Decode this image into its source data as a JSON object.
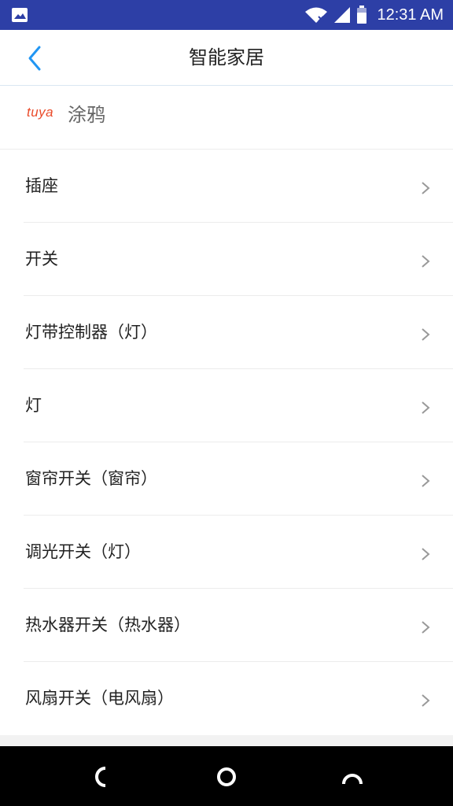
{
  "status_bar": {
    "time": "12:31 AM",
    "icons": [
      "image-icon",
      "wifi-icon",
      "signal-icon",
      "battery-icon"
    ]
  },
  "header": {
    "back_icon": "chevron-left-icon",
    "title": "智能家居"
  },
  "brand": {
    "logo_text": "tuya",
    "name": "涂鸦"
  },
  "list": {
    "items": [
      {
        "label": "插座"
      },
      {
        "label": "开关"
      },
      {
        "label": "灯带控制器（灯）"
      },
      {
        "label": "灯"
      },
      {
        "label": "窗帘开关（窗帘）"
      },
      {
        "label": "调光开关（灯）"
      },
      {
        "label": "热水器开关（热水器）"
      },
      {
        "label": "风扇开关（电风扇）"
      }
    ]
  },
  "nav_bar": {
    "icons": [
      "back-nav-icon",
      "home-nav-icon",
      "recents-nav-icon"
    ]
  },
  "colors": {
    "status_bar": "#2d3fa6",
    "accent": "#2196f3",
    "brand": "#ea4b2a"
  }
}
